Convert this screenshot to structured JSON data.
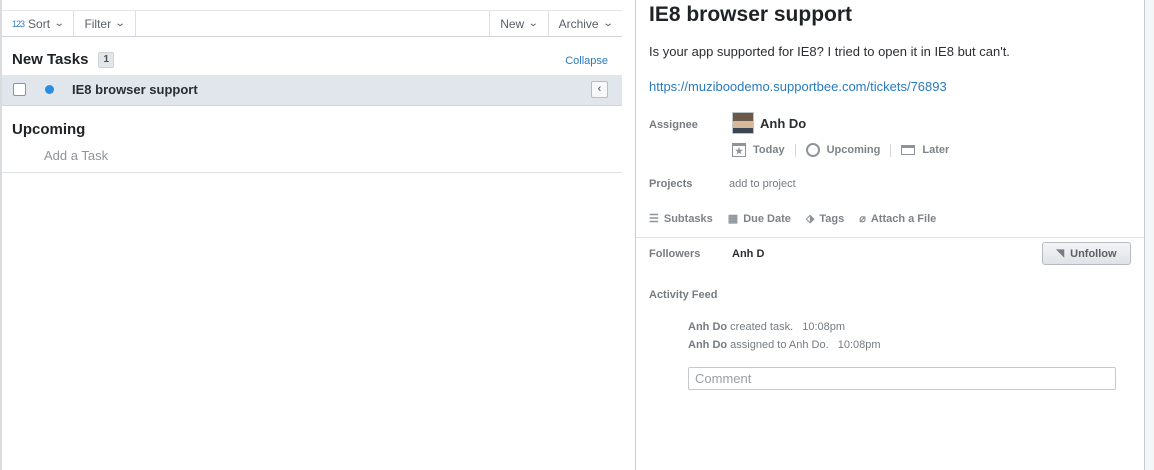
{
  "toolbar": {
    "sort_icon": "123",
    "sort_label": "Sort",
    "filter_label": "Filter",
    "new_label": "New",
    "archive_label": "Archive"
  },
  "left": {
    "new_tasks_heading": "New Tasks",
    "new_tasks_count": "1",
    "collapse_label": "Collapse",
    "tasks": [
      {
        "title": "IE8 browser support",
        "expand_glyph": "‹"
      }
    ],
    "upcoming_heading": "Upcoming",
    "add_task_label": "Add a Task"
  },
  "detail": {
    "title": "IE8 browser support",
    "description": "Is your app supported for IE8? I tried to open it in IE8 but can't.",
    "link": "https://muziboodemo.supportbee.com/tickets/76893",
    "assignee_label": "Assignee",
    "assignee_name": "Anh Do",
    "due_options": [
      "Today",
      "Upcoming",
      "Later"
    ],
    "projects_label": "Projects",
    "add_project_label": "add to project",
    "actions": [
      "Subtasks",
      "Due Date",
      "Tags",
      "Attach a File"
    ],
    "followers_label": "Followers",
    "follower_name": "Anh D",
    "unfollow_label": "Unfollow",
    "activity_label": "Activity Feed",
    "activity": [
      {
        "actor": "Anh Do",
        "text": "created task.",
        "time": "10:08pm"
      },
      {
        "actor": "Anh Do",
        "text": "assigned to Anh Do.",
        "time": "10:08pm"
      }
    ],
    "comment_placeholder": "Comment"
  },
  "colors": {
    "accent_link": "#2a7ac0",
    "task_dot": "#2a8de0",
    "selected_row": "#e1e6ec"
  }
}
